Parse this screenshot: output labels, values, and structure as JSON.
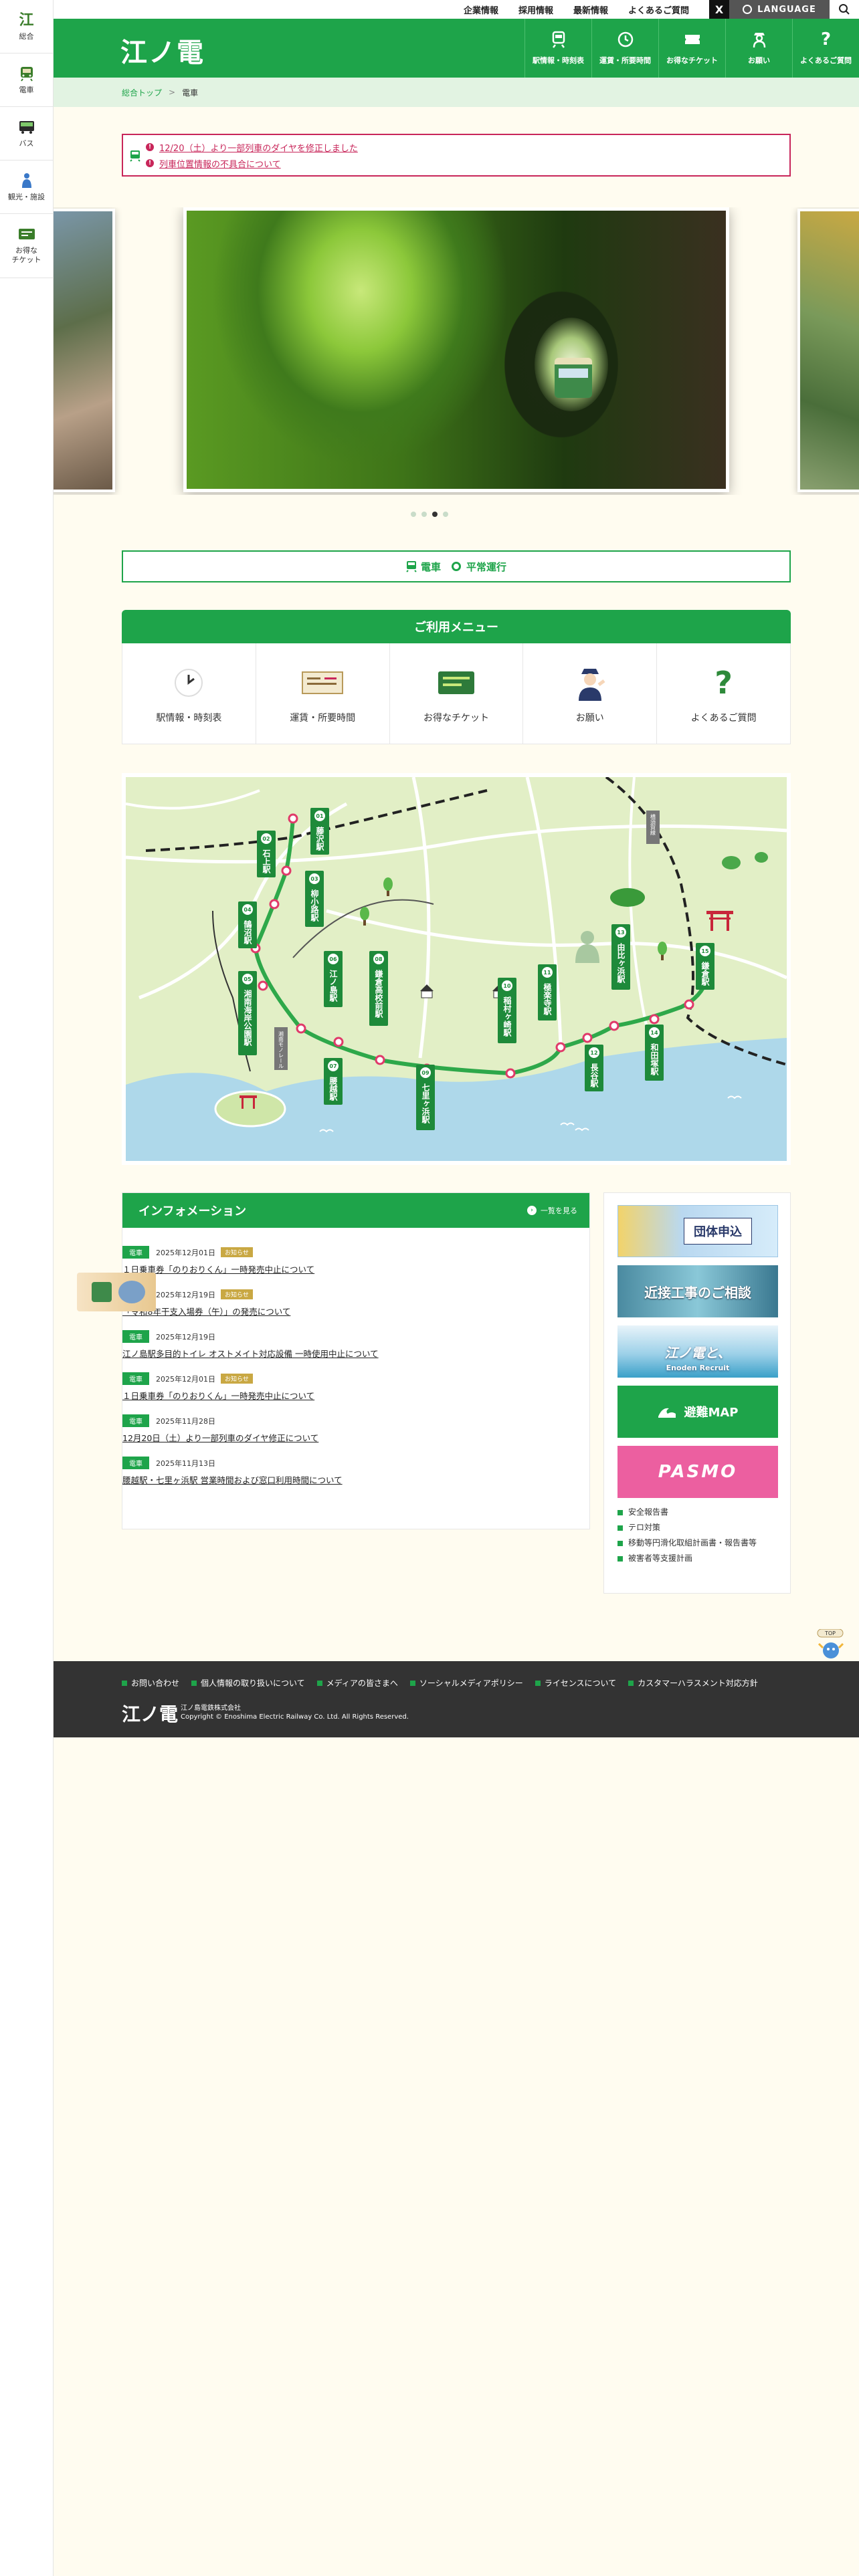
{
  "sidenav": {
    "items": [
      {
        "label": "総合",
        "icon": "enoden-logo-icon"
      },
      {
        "label": "電車",
        "icon": "tram-icon"
      },
      {
        "label": "バス",
        "icon": "bus-icon"
      },
      {
        "label": "観光・施設",
        "icon": "statue-icon"
      },
      {
        "label": "お得な\nチケット",
        "icon": "ticket-icon"
      }
    ],
    "brand_glyph": "江"
  },
  "utility": {
    "links": [
      "企業情報",
      "採用情報",
      "最新情報",
      "よくあるご質問"
    ],
    "x_label": "X",
    "language_label": "LANGUAGE"
  },
  "header": {
    "logo": "江ノ電",
    "nav": [
      {
        "label": "駅情報・時刻表",
        "icon": "station-icon"
      },
      {
        "label": "運賃・所要時間",
        "icon": "clock-icon"
      },
      {
        "label": "お得なチケット",
        "icon": "ticket-icon"
      },
      {
        "label": "お願い",
        "icon": "staff-icon"
      },
      {
        "label": "よくあるご質問",
        "icon": "question-icon"
      }
    ]
  },
  "breadcrumb": {
    "home": "総合トップ",
    "separator": ">",
    "current": "電車"
  },
  "notice": {
    "items": [
      "12/20（土）より一部列車のダイヤを修正しました",
      "列車位置情報の不具合について"
    ]
  },
  "status": {
    "line": "電車",
    "state": "平常運行"
  },
  "menu": {
    "title": "ご利用メニュー",
    "items": [
      {
        "label": "駅情報・時刻表",
        "icon": "clock-icon"
      },
      {
        "label": "運賃・所要時間",
        "icon": "fare-board-icon"
      },
      {
        "label": "お得なチケット",
        "icon": "ticket-icon"
      },
      {
        "label": "お願い",
        "icon": "staff-icon"
      },
      {
        "label": "よくあるご質問",
        "icon": "question-icon"
      }
    ]
  },
  "map": {
    "stations": [
      {
        "no": "01",
        "name": "藤沢駅"
      },
      {
        "no": "02",
        "name": "石上駅"
      },
      {
        "no": "03",
        "name": "柳小路駅"
      },
      {
        "no": "04",
        "name": "鵠沼駅"
      },
      {
        "no": "05",
        "name": "湘南海岸公園駅"
      },
      {
        "no": "06",
        "name": "江ノ島駅"
      },
      {
        "no": "07",
        "name": "腰越駅"
      },
      {
        "no": "08",
        "name": "鎌倉高校前駅"
      },
      {
        "no": "09",
        "name": "七里ヶ浜駅"
      },
      {
        "no": "10",
        "name": "稲村ヶ崎駅"
      },
      {
        "no": "11",
        "name": "極楽寺駅"
      },
      {
        "no": "12",
        "name": "長谷駅"
      },
      {
        "no": "13",
        "name": "由比ヶ浜駅"
      },
      {
        "no": "14",
        "name": "和田塚駅"
      },
      {
        "no": "15",
        "name": "鎌倉駅"
      }
    ],
    "extra_labels": [
      "湘南モノレール",
      "横須賀線"
    ]
  },
  "info": {
    "title": "インフォメーション",
    "all_label": "一覧を見る",
    "items": [
      {
        "tag": "電車",
        "date": "2025年12月01日",
        "badge": "お知らせ",
        "title": "１日乗車券「のりおりくん」一時発売中止について",
        "thumb": false
      },
      {
        "tag": "電車",
        "date": "2025年12月19日",
        "badge": "お知らせ",
        "title": "「令和8年干支入場券（午）」の発売について",
        "thumb": true
      },
      {
        "tag": "電車",
        "date": "2025年12月19日",
        "badge": "",
        "title": "江ノ島駅多目的トイレ オストメイト対応設備 一時使用中止について",
        "thumb": false
      },
      {
        "tag": "電車",
        "date": "2025年12月01日",
        "badge": "お知らせ",
        "title": "１日乗車券「のりおりくん」一時発売中止について",
        "thumb": false
      },
      {
        "tag": "電車",
        "date": "2025年11月28日",
        "badge": "",
        "title": "12月20日（土）より一部列車のダイヤ修正について",
        "thumb": false
      },
      {
        "tag": "電車",
        "date": "2025年11月13日",
        "badge": "",
        "title": "腰越駅・七里ヶ浜駅 営業時間および窓口利用時間について",
        "thumb": false
      }
    ]
  },
  "side": {
    "banners": [
      {
        "text": "団体申込"
      },
      {
        "text": "近接工事のご相談"
      },
      {
        "text": "江ノ電と、",
        "sub": "Enoden Recruit"
      },
      {
        "text": "避難MAP"
      },
      {
        "text": "PASMO"
      }
    ],
    "links": [
      "安全報告書",
      "テロ対策",
      "移動等円滑化取組計画書・報告書等",
      "被害者等支援計画"
    ]
  },
  "mascot": {
    "label": "TOP"
  },
  "footer": {
    "links": [
      "お問い合わせ",
      "個人情報の取り扱いについて",
      "メディアの皆さまへ",
      "ソーシャルメディアポリシー",
      "ライセンスについて",
      "カスタマーハラスメント対応方針"
    ],
    "logo": "江ノ電",
    "company": "江ノ島電鉄株式会社",
    "copyright": "Copyright © Enoshima Electric Railway Co. Ltd. All Rights Reserved."
  },
  "colors": {
    "brand_green": "#1ea44a",
    "alert": "#c8265a",
    "background": "#fffcf0",
    "footer": "#333333"
  }
}
